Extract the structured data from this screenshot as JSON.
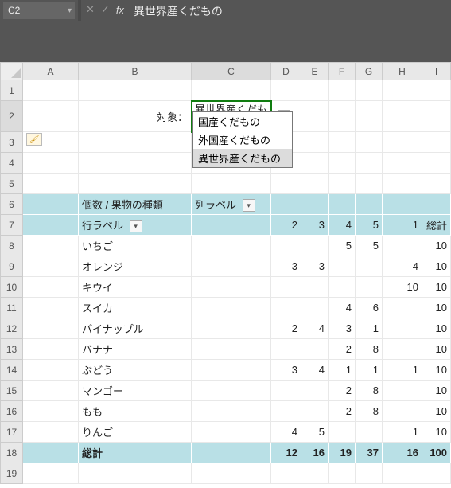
{
  "formula_bar": {
    "name_box": "C2",
    "fx_cancel": "✕",
    "fx_accept": "✓",
    "fx_label": "fx",
    "content": "異世界産くだもの"
  },
  "columns": [
    "A",
    "B",
    "C",
    "D",
    "E",
    "F",
    "G",
    "H",
    "I"
  ],
  "rows": [
    "1",
    "2",
    "3",
    "4",
    "5",
    "6",
    "7",
    "8",
    "9",
    "10",
    "11",
    "12",
    "13",
    "14",
    "15",
    "16",
    "17",
    "18",
    "19"
  ],
  "filter_label": "対象：",
  "filter_value": "異世界産くだもの",
  "dropdown": {
    "items": [
      "国産くだもの",
      "外国産くだもの",
      "異世界産くだもの"
    ],
    "selected_index": 2
  },
  "pivot": {
    "count_label": "個数 / 果物の種類",
    "col_label_text": "列ラベル",
    "row_label_text": "行ラベル",
    "totals_label": "総計",
    "col_headers": [
      "2",
      "3",
      "4",
      "5",
      "1",
      "総計"
    ],
    "rows": [
      {
        "label": "いちご",
        "vals": [
          "",
          "",
          "5",
          "5",
          "",
          "10"
        ]
      },
      {
        "label": "オレンジ",
        "vals": [
          "3",
          "3",
          "",
          "",
          "4",
          "10"
        ]
      },
      {
        "label": "キウイ",
        "vals": [
          "",
          "",
          "",
          "",
          "10",
          "10"
        ]
      },
      {
        "label": "スイカ",
        "vals": [
          "",
          "",
          "4",
          "6",
          "",
          "10"
        ]
      },
      {
        "label": "パイナップル",
        "vals": [
          "2",
          "4",
          "3",
          "1",
          "",
          "10"
        ]
      },
      {
        "label": "バナナ",
        "vals": [
          "",
          "",
          "2",
          "8",
          "",
          "10"
        ]
      },
      {
        "label": "ぶどう",
        "vals": [
          "3",
          "4",
          "1",
          "1",
          "1",
          "10"
        ]
      },
      {
        "label": "マンゴー",
        "vals": [
          "",
          "",
          "2",
          "8",
          "",
          "10"
        ]
      },
      {
        "label": "もも",
        "vals": [
          "",
          "",
          "2",
          "8",
          "",
          "10"
        ]
      },
      {
        "label": "りんご",
        "vals": [
          "4",
          "5",
          "",
          "",
          "1",
          "10"
        ]
      }
    ],
    "totals": [
      "12",
      "16",
      "19",
      "37",
      "16",
      "100"
    ]
  },
  "dropdown_glyph": "▾",
  "paste_badge_glyph": "🖌"
}
